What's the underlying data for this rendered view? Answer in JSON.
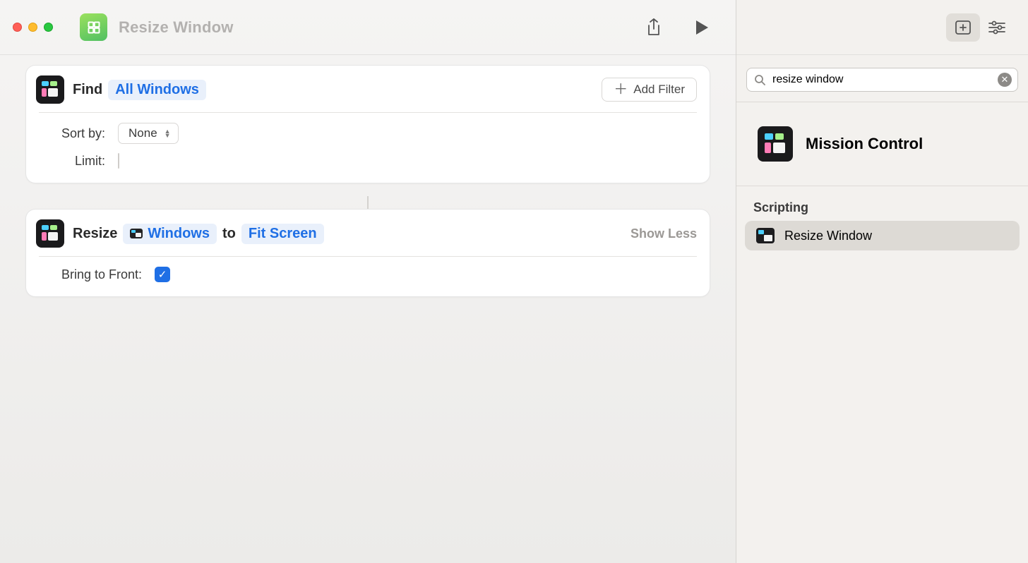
{
  "title": "Resize Window",
  "actions": {
    "find": {
      "verb": "Find",
      "target_token": "All Windows",
      "add_filter_label": "Add Filter",
      "sort_by_label": "Sort by:",
      "sort_by_value": "None",
      "limit_label": "Limit:",
      "limit_checked": false
    },
    "resize": {
      "verb": "Resize",
      "target_token": "Windows",
      "joiner": "to",
      "size_token": "Fit Screen",
      "show_less_label": "Show Less",
      "bring_front_label": "Bring to Front:",
      "bring_front_checked": true
    }
  },
  "library": {
    "search_value": "resize window",
    "app_header": "Mission Control",
    "category": "Scripting",
    "items": [
      {
        "label": "Resize Window",
        "selected": true
      }
    ]
  },
  "icons": {
    "share": "share-icon",
    "run": "play-icon",
    "library_tab": "library-icon",
    "settings_tab": "sliders-icon",
    "search": "magnifier-icon",
    "clear": "x-circle-icon",
    "plus": "plus-icon"
  }
}
